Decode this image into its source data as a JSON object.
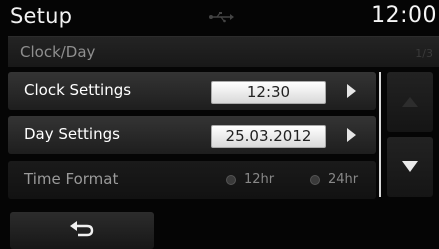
{
  "header": {
    "title": "Setup",
    "clock": "12:00",
    "usb_icon": "usb-icon"
  },
  "subheader": {
    "title": "Clock/Day",
    "page": "1/3"
  },
  "rows": [
    {
      "label": "Clock Settings",
      "value": "12:30"
    },
    {
      "label": "Day Settings",
      "value": "25.03.2012"
    },
    {
      "label": "Time Format",
      "options": [
        "12hr",
        "24hr"
      ]
    }
  ],
  "scroll": {
    "up_icon": "scroll-up-icon",
    "down_icon": "scroll-down-icon"
  },
  "back": {
    "icon": "back-arrow-icon"
  }
}
